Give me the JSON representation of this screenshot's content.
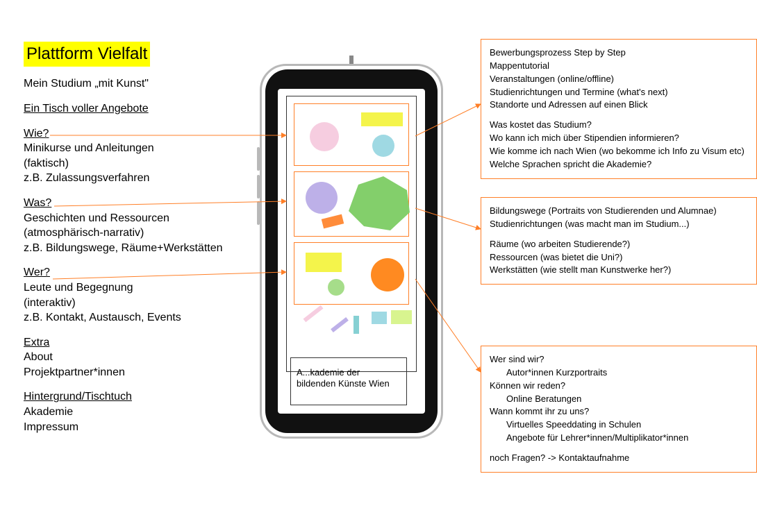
{
  "title": "Plattform Vielfalt",
  "subtitle": "Mein Studium „mit Kunst\"",
  "left": {
    "heading_offers": "Ein Tisch voller Angebote",
    "wie_h": "Wie?",
    "wie_l1": "Minikurse und Anleitungen",
    "wie_l2": "(faktisch)",
    "wie_l3": "z.B. Zulassungsverfahren",
    "was_h": "Was?",
    "was_l1": "Geschichten und Ressourcen",
    "was_l2": "(atmosphärisch-narrativ)",
    "was_l3": "z.B. Bildungswege, Räume+Werkstätten",
    "wer_h": "Wer?",
    "wer_l1": "Leute und Begegnung",
    "wer_l2": "(interaktiv)",
    "wer_l3": "z.B. Kontakt, Austausch, Events",
    "extra_h": "Extra",
    "extra_l1": "About",
    "extra_l2": "Projektpartner*innen",
    "bg_h": "Hintergrund/Tischtuch",
    "bg_l1": "Akademie",
    "bg_l2": "Impressum"
  },
  "phone": {
    "footer_l1": "A...kademie der",
    "footer_l2": "bildenden Künste Wien"
  },
  "box1": {
    "l1": "Bewerbungsprozess Step by Step",
    "l2": "Mappentutorial",
    "l3": "Veranstaltungen (online/offline)",
    "l4": "Studienrichtungen und Termine (what's next)",
    "l5": "Standorte und Adressen auf einen Blick",
    "l6": "Was kostet das Studium?",
    "l7": "Wo kann ich mich über Stipendien informieren?",
    "l8": "Wie komme ich nach Wien (wo bekomme ich Info zu Visum etc)",
    "l9": "Welche Sprachen spricht die Akademie?"
  },
  "box2": {
    "l1": "Bildungswege (Portraits von Studierenden und Alumnae)",
    "l2": "Studienrichtungen (was macht man im Studium...)",
    "l3": "Räume (wo arbeiten Studierende?)",
    "l4": "Ressourcen (was bietet die Uni?)",
    "l5": "Werkstätten (wie stellt man Kunstwerke her?)"
  },
  "box3": {
    "l1": "Wer sind wir?",
    "l1a": "Autor*innen Kurzportraits",
    "l2": "Können wir reden?",
    "l2a": "Online Beratungen",
    "l3": "Wann kommt ihr zu uns?",
    "l3a": "Virtuelles Speeddating in Schulen",
    "l3b": "Angebote für Lehrer*innen/Multiplikator*innen",
    "l4": "noch Fragen? -> Kontaktaufnahme"
  }
}
